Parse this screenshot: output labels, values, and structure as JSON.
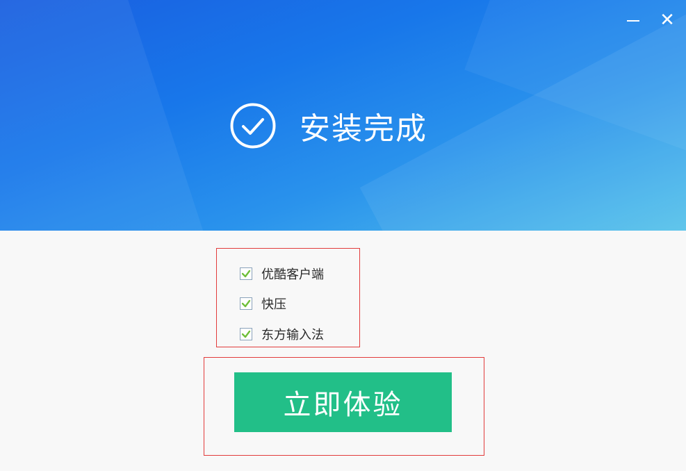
{
  "window": {
    "minimize_icon": "minimize-icon",
    "close_icon": "close-icon",
    "close_glyph": "✕"
  },
  "header": {
    "title": "安装完成",
    "icon": "check-circle-icon",
    "gradient_colors": [
      "#1a5fe0",
      "#1877ea",
      "#2a93ec",
      "#55c2ea"
    ]
  },
  "options": [
    {
      "label": "优酷客户端",
      "checked": true
    },
    {
      "label": "快压",
      "checked": true
    },
    {
      "label": "东方输入法",
      "checked": true
    }
  ],
  "primary_button": {
    "label": "立即体验",
    "color": "#22bf88"
  },
  "highlight_color": "#e23b3b",
  "checkmark_color": "#6fbf3a"
}
